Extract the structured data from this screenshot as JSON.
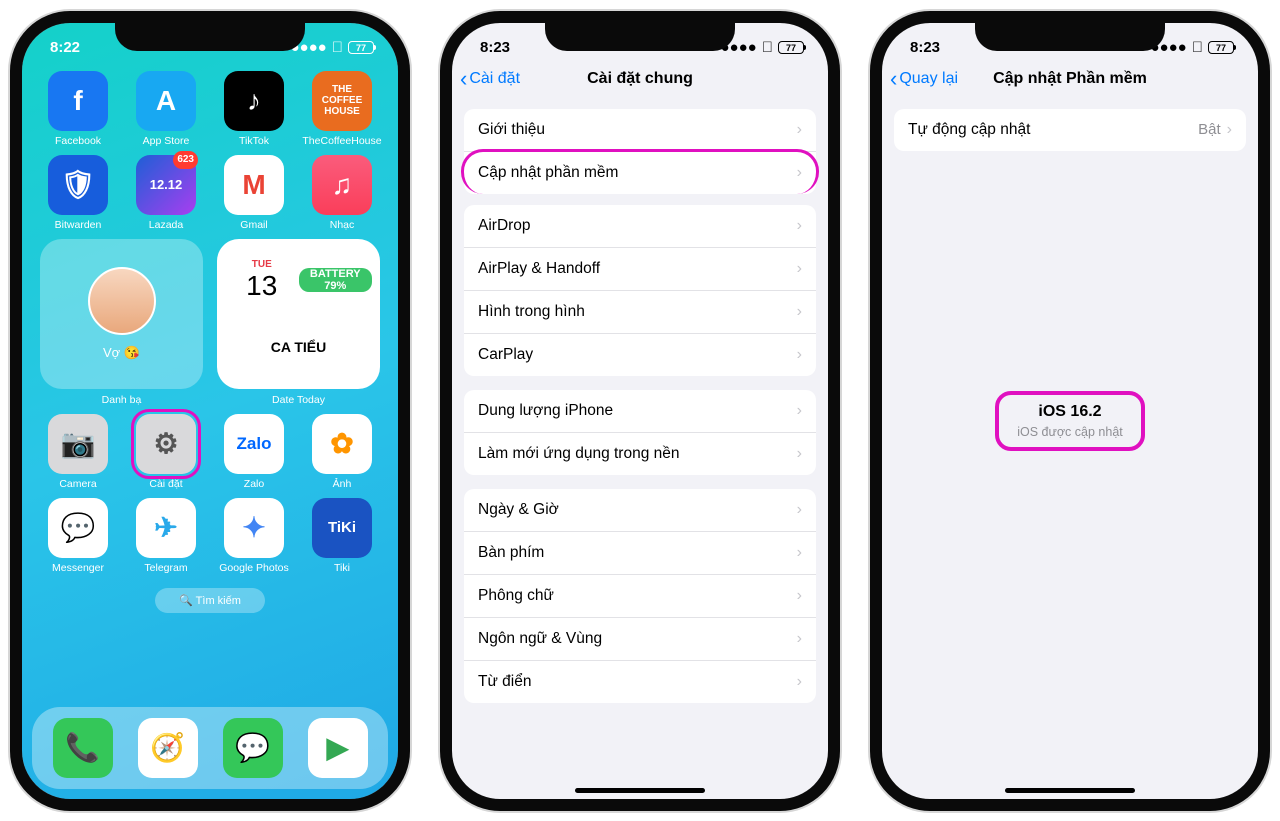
{
  "phone1": {
    "time": "8:22",
    "battery": "77",
    "apps_row1": [
      {
        "label": "Facebook",
        "bg": "#1877f2",
        "glyph": "f"
      },
      {
        "label": "App Store",
        "bg": "#18a8f2",
        "glyph": "A"
      },
      {
        "label": "TikTok",
        "bg": "#000",
        "glyph": "♪"
      },
      {
        "label": "TheCoffeeHouse",
        "bg": "#e96c1f",
        "glyph": "☕"
      }
    ],
    "apps_row2": [
      {
        "label": "Bitwarden",
        "bg": "#175ddc",
        "glyph": "🛡",
        "badge": ""
      },
      {
        "label": "Lazada",
        "bg": "#1d5fd6",
        "glyph": "12.12",
        "badge": "623"
      },
      {
        "label": "Gmail",
        "bg": "#fff",
        "glyph": "M",
        "badge": ""
      },
      {
        "label": "Nhạc",
        "bg": "#fa3e5a",
        "glyph": "♫",
        "badge": ""
      }
    ],
    "widget_contact_label": "Vợ 😘",
    "widget_contact_caption": "Danh bạ",
    "widget_date_day": "TUE",
    "widget_date_num": "13",
    "widget_batt_label": "BATTERY",
    "widget_batt_val": "79%",
    "widget_shift": "CA TIỂU",
    "widget_date_caption": "Date Today",
    "apps_row3": [
      {
        "label": "Camera",
        "bg": "#d9d9db",
        "glyph": "📷"
      },
      {
        "label": "Cài đặt",
        "bg": "#d9d9db",
        "glyph": "⚙"
      },
      {
        "label": "Zalo",
        "bg": "#fff",
        "glyph": "Zalo"
      },
      {
        "label": "Ảnh",
        "bg": "#fff",
        "glyph": "✿"
      }
    ],
    "apps_row4": [
      {
        "label": "Messenger",
        "bg": "#fff",
        "glyph": "💬"
      },
      {
        "label": "Telegram",
        "bg": "#fff",
        "glyph": "✈"
      },
      {
        "label": "Google Photos",
        "bg": "#fff",
        "glyph": "✦"
      },
      {
        "label": "Tiki",
        "bg": "#1a53c2",
        "glyph": "TiKi"
      }
    ],
    "search": "🔍 Tìm kiếm",
    "dock": [
      {
        "bg": "#34c759",
        "glyph": "📞"
      },
      {
        "bg": "#fff",
        "glyph": "🧭"
      },
      {
        "bg": "#34c759",
        "glyph": "💬"
      },
      {
        "bg": "#34a853",
        "glyph": "▶"
      }
    ]
  },
  "phone2": {
    "time": "8:23",
    "battery": "77",
    "back": "Cài đặt",
    "title": "Cài đặt chung",
    "g1": [
      "Giới thiệu",
      "Cập nhật phần mềm"
    ],
    "g2": [
      "AirDrop",
      "AirPlay & Handoff",
      "Hình trong hình",
      "CarPlay"
    ],
    "g3": [
      "Dung lượng iPhone",
      "Làm mới ứng dụng trong nền"
    ],
    "g4": [
      "Ngày & Giờ",
      "Bàn phím",
      "Phông chữ",
      "Ngôn ngữ & Vùng",
      "Từ điển"
    ]
  },
  "phone3": {
    "time": "8:23",
    "battery": "77",
    "back": "Quay lại",
    "title": "Cập nhật Phần mềm",
    "auto_label": "Tự động cập nhật",
    "auto_value": "Bật",
    "version": "iOS 16.2",
    "status": "iOS được cập nhật"
  }
}
